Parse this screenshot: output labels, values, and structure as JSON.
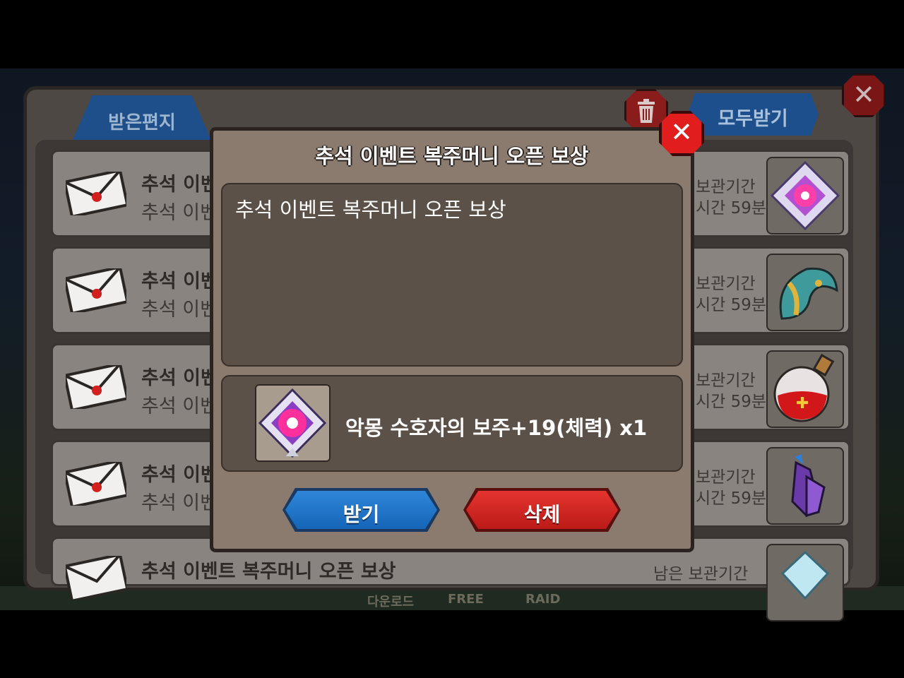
{
  "tabs": {
    "received": "받은편지"
  },
  "header": {
    "receive_all": "모두받기"
  },
  "mails": [
    {
      "title": "추석 이벤",
      "subtitle": "추석 이벤",
      "expiry_1": "보관기간",
      "expiry_2": "시간 59분",
      "item": "orb"
    },
    {
      "title": "추석 이벤",
      "subtitle": "추석 이벤",
      "expiry_1": "보관기간",
      "expiry_2": "시간 59분",
      "item": "helmet"
    },
    {
      "title": "추석 이벤",
      "subtitle": "추석 이벤",
      "expiry_1": "보관기간",
      "expiry_2": "시간 59분",
      "item": "potion"
    },
    {
      "title": "추석 이벤",
      "subtitle": "추석 이벤",
      "expiry_1": "보관기간",
      "expiry_2": "시간 59분",
      "item": "crystal"
    },
    {
      "title": "추석 이벤트 복주머니 오픈 보상",
      "expiry_1": "남은 보관기간",
      "item": "diamond"
    }
  ],
  "background": {
    "labels": [
      "다운로드",
      "FREE",
      "RAID"
    ]
  },
  "dialog": {
    "title": "추석 이벤트 복주머니 오픈 보상",
    "message": "추석 이벤트 복주머니 오픈 보상",
    "reward": {
      "name": "악몽 수호자의 보주+19(체력) x1",
      "icon": "orb"
    },
    "accept_label": "받기",
    "delete_label": "삭제"
  },
  "colors": {
    "accept": "#1f72c8",
    "delete": "#d12622",
    "panel": "#8a7b6e"
  }
}
